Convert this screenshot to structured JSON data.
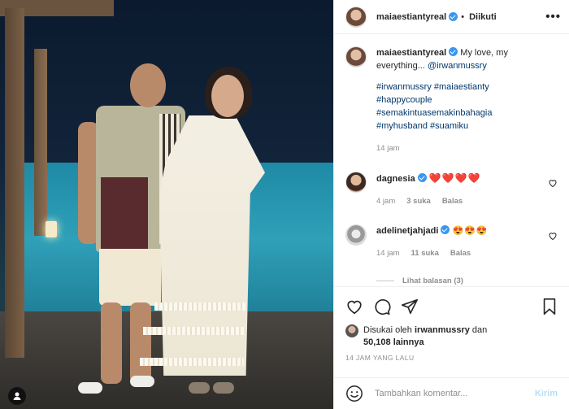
{
  "post": {
    "author": "maiaestiantyreal",
    "follow_status": "Diikuti",
    "more_label": "•••",
    "caption": {
      "mention_prefix": "My love, my everything... ",
      "mention": "@irwanmussry",
      "hashtags_line1": "#irwanmussry #maiaestianty",
      "hashtags_line2": "#happycouple",
      "hashtags_line3": "#semakintuasemakinbahagia",
      "hashtags_line4": "#myhusband #suamiku",
      "time": "14 jam"
    }
  },
  "comments": [
    {
      "user": "dagnesia",
      "text": "❤️❤️❤️❤️",
      "time": "4 jam",
      "likes": "3 suka",
      "reply": "Balas"
    },
    {
      "user": "adelinetjahjadi",
      "text": "😍😍😍",
      "time": "14 jam",
      "likes": "11 suka",
      "reply": "Balas"
    }
  ],
  "replies": {
    "label": "Lihat balasan (3)"
  },
  "likes": {
    "prefix": "Disukai oleh",
    "user": "irwanmussry",
    "and": "dan",
    "count": "50,108 lainnya"
  },
  "timestamp": "14 JAM YANG LALU",
  "add_comment": {
    "placeholder": "Tambahkan komentar...",
    "post_label": "Kirim"
  },
  "colors": {
    "link": "#00376b",
    "verified": "#3897f0",
    "muted": "#8e8e8e",
    "post_disabled": "#b2dffc"
  }
}
